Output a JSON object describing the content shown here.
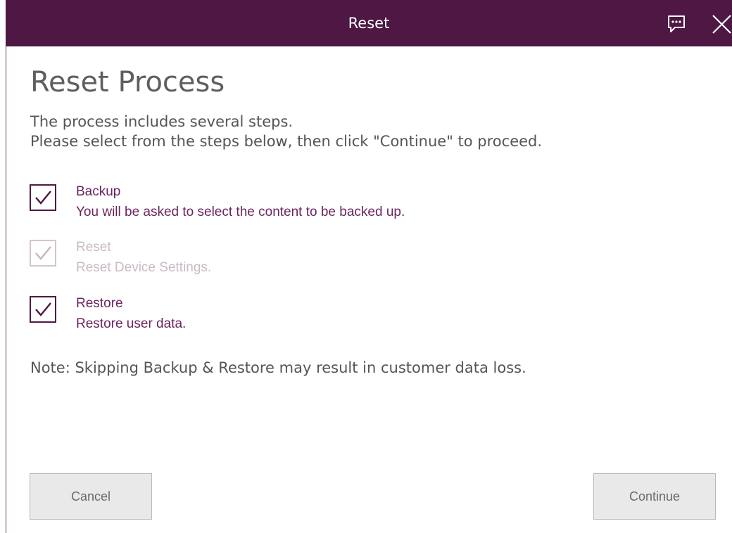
{
  "window": {
    "title": "Reset"
  },
  "icons": {
    "feedback": "feedback-icon",
    "close": "close-icon",
    "check": "checkmark-icon"
  },
  "colors": {
    "titlebar": "#4e1744",
    "accent": "#6b2460",
    "disabled": "#c9bac6"
  },
  "page": {
    "title": "Reset Process",
    "intro_line1": "The process includes several steps.",
    "intro_line2": "Please select from the steps below, then click \"Continue\" to proceed."
  },
  "steps": [
    {
      "name": "Backup",
      "description": "You will be asked to select the content to be backed up.",
      "checked": true,
      "enabled": true
    },
    {
      "name": "Reset",
      "description": "Reset Device Settings.",
      "checked": true,
      "enabled": false
    },
    {
      "name": "Restore",
      "description": "Restore user data.",
      "checked": true,
      "enabled": true
    }
  ],
  "note": "Note: Skipping Backup & Restore may result in customer data loss.",
  "buttons": {
    "cancel": "Cancel",
    "continue": "Continue"
  }
}
